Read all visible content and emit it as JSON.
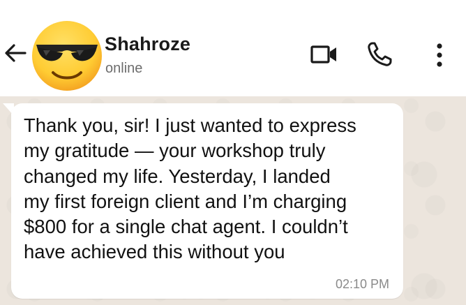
{
  "header": {
    "contact_name": "Shahroze",
    "status": "online"
  },
  "icons": {
    "back": "arrow-left-icon",
    "avatar": "sunglasses-emoji-avatar",
    "video": "video-call-icon",
    "voice": "phone-call-icon",
    "menu": "more-vertical-icon"
  },
  "message": {
    "text": "Thank you, sir! I just wanted to express\nmy gratitude — your workshop truly\nchanged my life. Yesterday, I landed\nmy first foreign client and I’m charging\n$800 for a single chat agent. I couldn’t\nhave achieved this without you",
    "time": "02:10 PM",
    "direction": "incoming"
  },
  "colors": {
    "chat_background": "#ece5dd",
    "bubble": "#ffffff",
    "header": "#ffffff"
  }
}
